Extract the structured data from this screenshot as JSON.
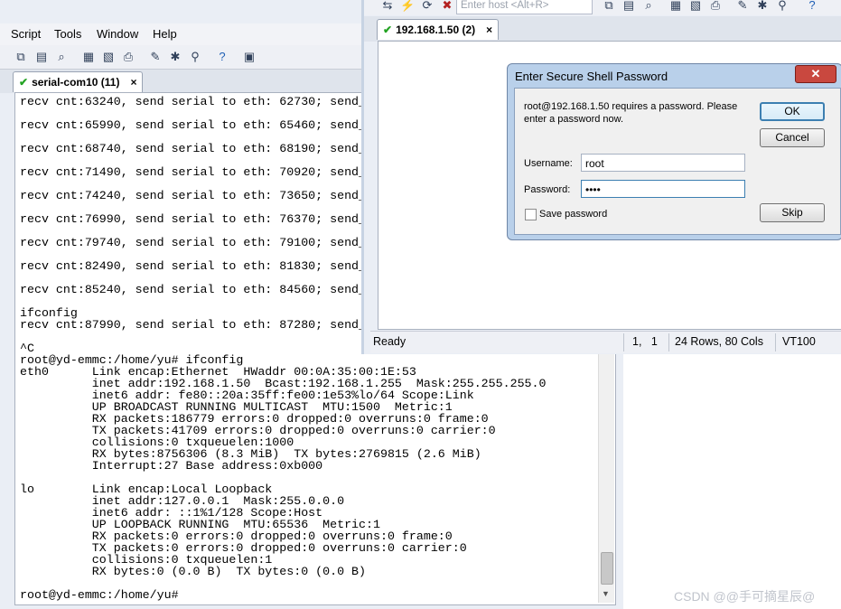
{
  "menu": [
    "Script",
    "Tools",
    "Window",
    "Help"
  ],
  "toolbar_icons": [
    "copy-icon",
    "paste-icon",
    "find-icon",
    "print-setup-icon",
    "print-preview-icon",
    "print-icon",
    "session-options-icon",
    "global-options-icon",
    "keymap-icon",
    "help-icon",
    "map-icon"
  ],
  "left_tab": {
    "label": "serial-com10 (11)",
    "close": "×"
  },
  "terminal_lines": [
    "recv cnt:63240, send serial to eth: 62730; send_",
    "recv cnt:65990, send serial to eth: 65460; send_",
    "recv cnt:68740, send serial to eth: 68190; send_",
    "recv cnt:71490, send serial to eth: 70920; send_",
    "recv cnt:74240, send serial to eth: 73650; send_",
    "recv cnt:76990, send serial to eth: 76370; send_",
    "recv cnt:79740, send serial to eth: 79100; send_",
    "recv cnt:82490, send serial to eth: 81830; send_",
    "recv cnt:85240, send serial to eth: 84560; send_",
    "ifconfig",
    "recv cnt:87990, send serial to eth: 87280; send_",
    "^C",
    "root@yd-emmc:/home/yu# ifconfig",
    "eth0      Link encap:Ethernet  HWaddr 00:0A:35:00:1E:53",
    "          inet addr:192.168.1.50  Bcast:192.168.1.255  Mask:255.255.255.0",
    "          inet6 addr: fe80::20a:35ff:fe00:1e53%lo/64 Scope:Link",
    "          UP BROADCAST RUNNING MULTICAST  MTU:1500  Metric:1",
    "          RX packets:186779 errors:0 dropped:0 overruns:0 frame:0",
    "          TX packets:41709 errors:0 dropped:0 overruns:0 carrier:0",
    "          collisions:0 txqueuelen:1000",
    "          RX bytes:8756306 (8.3 MiB)  TX bytes:2769815 (2.6 MiB)",
    "          Interrupt:27 Base address:0xb000",
    "lo        Link encap:Local Loopback",
    "          inet addr:127.0.0.1  Mask:255.0.0.0",
    "          inet6 addr: ::1%1/128 Scope:Host",
    "          UP LOOPBACK RUNNING  MTU:65536  Metric:1",
    "          RX packets:0 errors:0 dropped:0 overruns:0 frame:0",
    "          TX packets:0 errors:0 dropped:0 overruns:0 carrier:0",
    "          collisions:0 txqueuelen:1",
    "          RX bytes:0 (0.0 B)  TX bytes:0 (0.0 B)",
    "root@yd-emmc:/home/yu#"
  ],
  "right_window": {
    "host_placeholder": "Enter host <Alt+R>",
    "tab": {
      "label": "192.168.1.50 (2)",
      "close": "×"
    },
    "status": {
      "state": "Ready",
      "position": "1,   1",
      "size": "24 Rows, 80 Cols",
      "emulation": "VT100"
    }
  },
  "dialog": {
    "title": "Enter Secure Shell Password",
    "close": "✕",
    "message_line1": "root@192.168.1.50 requires a password.  Please",
    "message_line2": "enter a password now.",
    "username_label": "Username:",
    "username_value": "root",
    "password_label": "Password:",
    "password_value": "••••",
    "save_label": "Save password",
    "ok": "OK",
    "cancel": "Cancel",
    "skip": "Skip"
  },
  "watermark": "CSDN @@手可摘星辰@"
}
